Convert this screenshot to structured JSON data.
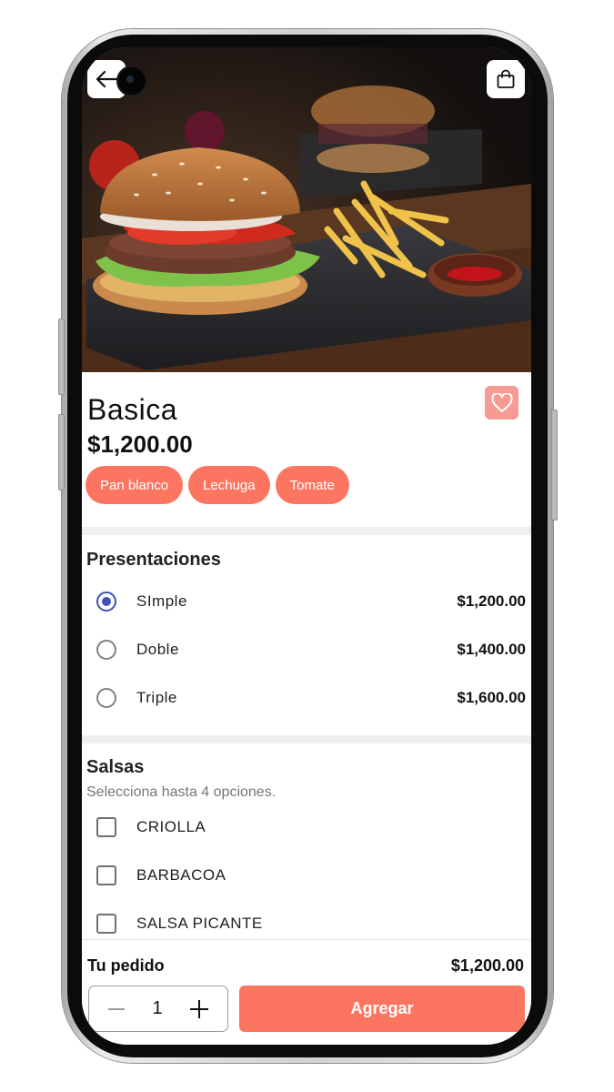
{
  "product": {
    "name": "Basica",
    "price": "$1,200.00",
    "ingredients": [
      "Pan blanco",
      "Lechuga",
      "Tomate"
    ]
  },
  "presentaciones": {
    "title": "Presentaciones",
    "selected": "SImple",
    "options": [
      {
        "label": "SImple",
        "price": "$1,200.00"
      },
      {
        "label": "Doble",
        "price": "$1,400.00"
      },
      {
        "label": "Triple",
        "price": "$1,600.00"
      }
    ]
  },
  "salsas": {
    "title": "Salsas",
    "subtitle": "Selecciona hasta 4 opciones.",
    "options": [
      "CRIOLLA",
      "BARBACOA",
      "SALSA PICANTE"
    ]
  },
  "order": {
    "label": "Tu pedido",
    "total": "$1,200.00",
    "quantity": "1",
    "add_label": "Agregar"
  },
  "icons": {
    "back": "arrow-left-icon",
    "cart": "shopping-bag-icon",
    "favorite": "heart-icon",
    "decrease": "minus-icon",
    "increase": "plus-icon"
  },
  "colors": {
    "accent": "#fb7561",
    "favorite_bg": "#f79b92",
    "radio_selected": "#3f51b5"
  }
}
